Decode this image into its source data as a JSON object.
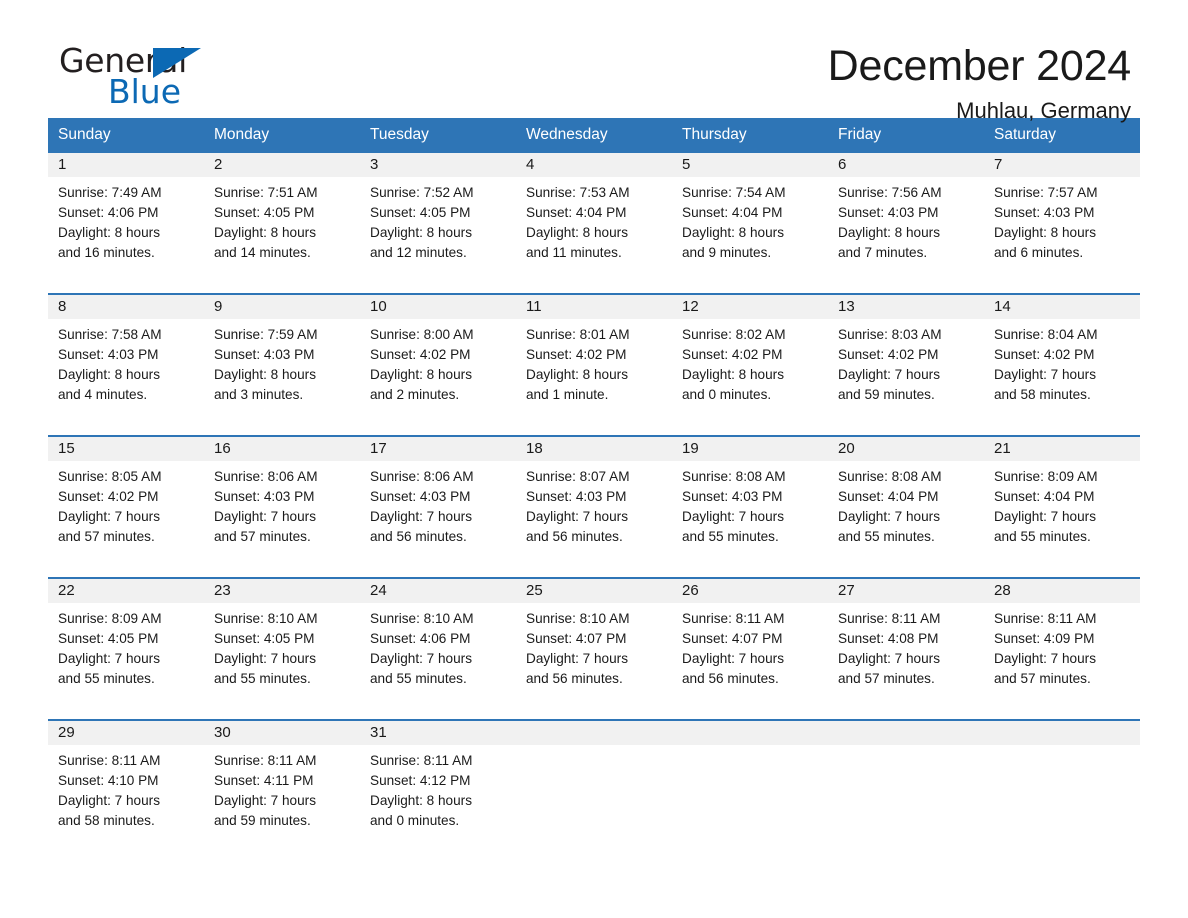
{
  "brand": {
    "name_part1": "General",
    "name_part2": "Blue",
    "triangle_color": "#0c69b4",
    "accent_color": "#2e75b6"
  },
  "header": {
    "month_title": "December 2024",
    "location": "Muhlau, Germany"
  },
  "weekday_headers": [
    "Sunday",
    "Monday",
    "Tuesday",
    "Wednesday",
    "Thursday",
    "Friday",
    "Saturday"
  ],
  "weeks": [
    {
      "days": [
        {
          "num": "1",
          "detail": "Sunrise: 7:49 AM\nSunset: 4:06 PM\nDaylight: 8 hours\nand 16 minutes."
        },
        {
          "num": "2",
          "detail": "Sunrise: 7:51 AM\nSunset: 4:05 PM\nDaylight: 8 hours\nand 14 minutes."
        },
        {
          "num": "3",
          "detail": "Sunrise: 7:52 AM\nSunset: 4:05 PM\nDaylight: 8 hours\nand 12 minutes."
        },
        {
          "num": "4",
          "detail": "Sunrise: 7:53 AM\nSunset: 4:04 PM\nDaylight: 8 hours\nand 11 minutes."
        },
        {
          "num": "5",
          "detail": "Sunrise: 7:54 AM\nSunset: 4:04 PM\nDaylight: 8 hours\nand 9 minutes."
        },
        {
          "num": "6",
          "detail": "Sunrise: 7:56 AM\nSunset: 4:03 PM\nDaylight: 8 hours\nand 7 minutes."
        },
        {
          "num": "7",
          "detail": "Sunrise: 7:57 AM\nSunset: 4:03 PM\nDaylight: 8 hours\nand 6 minutes."
        }
      ]
    },
    {
      "days": [
        {
          "num": "8",
          "detail": "Sunrise: 7:58 AM\nSunset: 4:03 PM\nDaylight: 8 hours\nand 4 minutes."
        },
        {
          "num": "9",
          "detail": "Sunrise: 7:59 AM\nSunset: 4:03 PM\nDaylight: 8 hours\nand 3 minutes."
        },
        {
          "num": "10",
          "detail": "Sunrise: 8:00 AM\nSunset: 4:02 PM\nDaylight: 8 hours\nand 2 minutes."
        },
        {
          "num": "11",
          "detail": "Sunrise: 8:01 AM\nSunset: 4:02 PM\nDaylight: 8 hours\nand 1 minute."
        },
        {
          "num": "12",
          "detail": "Sunrise: 8:02 AM\nSunset: 4:02 PM\nDaylight: 8 hours\nand 0 minutes."
        },
        {
          "num": "13",
          "detail": "Sunrise: 8:03 AM\nSunset: 4:02 PM\nDaylight: 7 hours\nand 59 minutes."
        },
        {
          "num": "14",
          "detail": "Sunrise: 8:04 AM\nSunset: 4:02 PM\nDaylight: 7 hours\nand 58 minutes."
        }
      ]
    },
    {
      "days": [
        {
          "num": "15",
          "detail": "Sunrise: 8:05 AM\nSunset: 4:02 PM\nDaylight: 7 hours\nand 57 minutes."
        },
        {
          "num": "16",
          "detail": "Sunrise: 8:06 AM\nSunset: 4:03 PM\nDaylight: 7 hours\nand 57 minutes."
        },
        {
          "num": "17",
          "detail": "Sunrise: 8:06 AM\nSunset: 4:03 PM\nDaylight: 7 hours\nand 56 minutes."
        },
        {
          "num": "18",
          "detail": "Sunrise: 8:07 AM\nSunset: 4:03 PM\nDaylight: 7 hours\nand 56 minutes."
        },
        {
          "num": "19",
          "detail": "Sunrise: 8:08 AM\nSunset: 4:03 PM\nDaylight: 7 hours\nand 55 minutes."
        },
        {
          "num": "20",
          "detail": "Sunrise: 8:08 AM\nSunset: 4:04 PM\nDaylight: 7 hours\nand 55 minutes."
        },
        {
          "num": "21",
          "detail": "Sunrise: 8:09 AM\nSunset: 4:04 PM\nDaylight: 7 hours\nand 55 minutes."
        }
      ]
    },
    {
      "days": [
        {
          "num": "22",
          "detail": "Sunrise: 8:09 AM\nSunset: 4:05 PM\nDaylight: 7 hours\nand 55 minutes."
        },
        {
          "num": "23",
          "detail": "Sunrise: 8:10 AM\nSunset: 4:05 PM\nDaylight: 7 hours\nand 55 minutes."
        },
        {
          "num": "24",
          "detail": "Sunrise: 8:10 AM\nSunset: 4:06 PM\nDaylight: 7 hours\nand 55 minutes."
        },
        {
          "num": "25",
          "detail": "Sunrise: 8:10 AM\nSunset: 4:07 PM\nDaylight: 7 hours\nand 56 minutes."
        },
        {
          "num": "26",
          "detail": "Sunrise: 8:11 AM\nSunset: 4:07 PM\nDaylight: 7 hours\nand 56 minutes."
        },
        {
          "num": "27",
          "detail": "Sunrise: 8:11 AM\nSunset: 4:08 PM\nDaylight: 7 hours\nand 57 minutes."
        },
        {
          "num": "28",
          "detail": "Sunrise: 8:11 AM\nSunset: 4:09 PM\nDaylight: 7 hours\nand 57 minutes."
        }
      ]
    },
    {
      "days": [
        {
          "num": "29",
          "detail": "Sunrise: 8:11 AM\nSunset: 4:10 PM\nDaylight: 7 hours\nand 58 minutes."
        },
        {
          "num": "30",
          "detail": "Sunrise: 8:11 AM\nSunset: 4:11 PM\nDaylight: 7 hours\nand 59 minutes."
        },
        {
          "num": "31",
          "detail": "Sunrise: 8:11 AM\nSunset: 4:12 PM\nDaylight: 8 hours\nand 0 minutes."
        },
        {
          "num": "",
          "detail": ""
        },
        {
          "num": "",
          "detail": ""
        },
        {
          "num": "",
          "detail": ""
        },
        {
          "num": "",
          "detail": ""
        }
      ]
    }
  ]
}
